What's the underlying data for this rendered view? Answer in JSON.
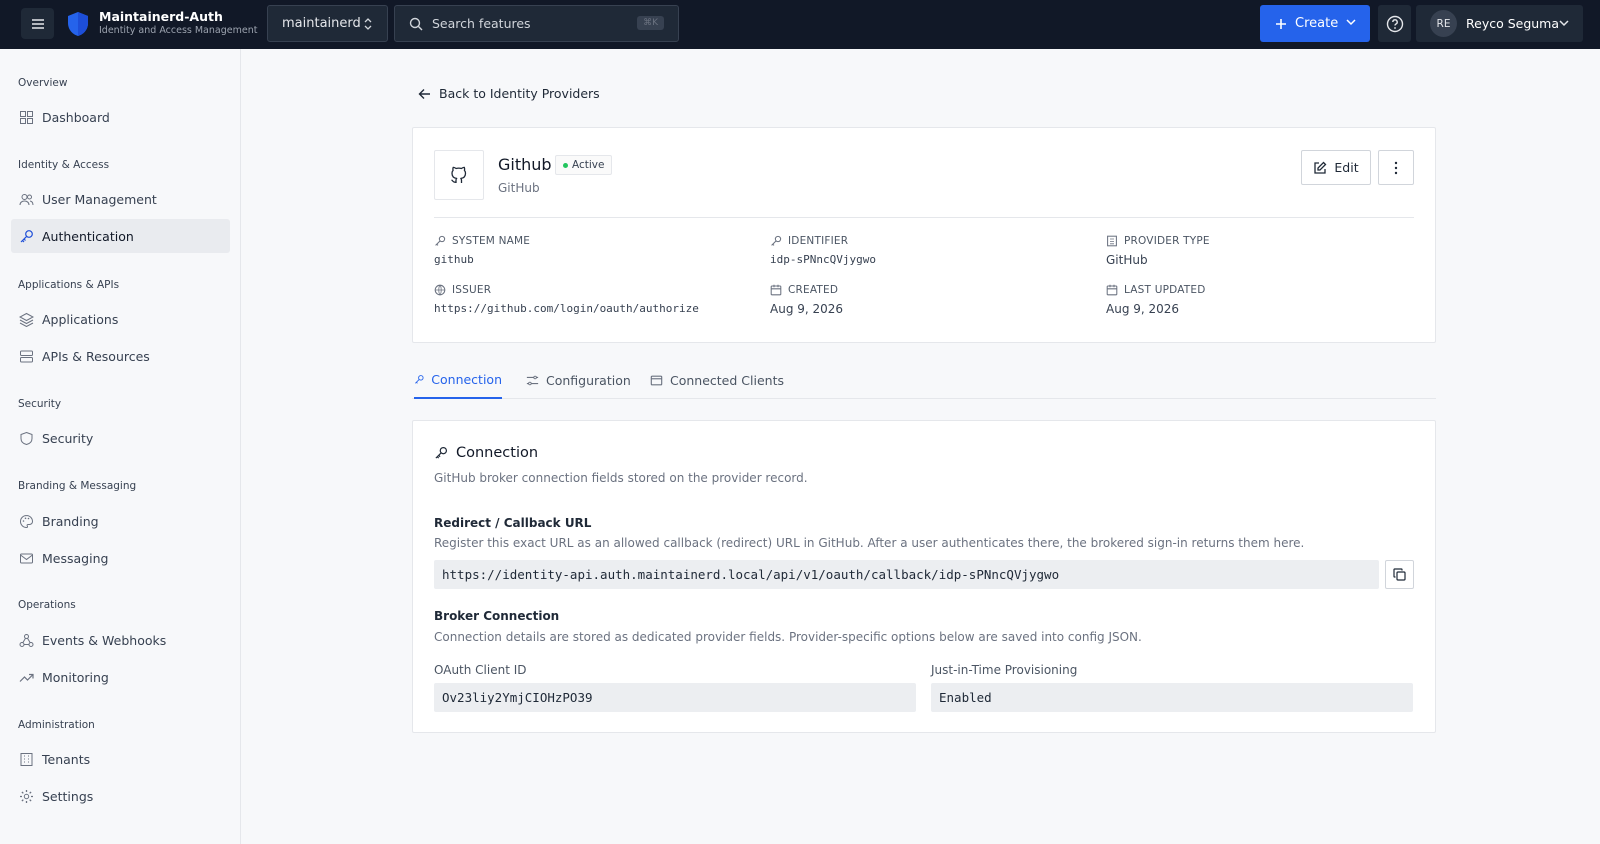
{
  "app": {
    "name": "Maintainerd-Auth",
    "subtitle": "Identity and Access Management",
    "tenant": "maintainerd",
    "search_placeholder": "Search features",
    "search_shortcut": "⌘K",
    "create_label": "Create",
    "user_initials": "RE",
    "user_name": "Reyco Seguma"
  },
  "sidebar": {
    "sections": [
      {
        "title": "Overview",
        "items": [
          "Dashboard"
        ]
      },
      {
        "title": "Identity & Access",
        "items": [
          "User Management",
          "Authentication"
        ]
      },
      {
        "title": "Applications & APIs",
        "items": [
          "Applications",
          "APIs & Resources"
        ]
      },
      {
        "title": "Security",
        "items": [
          "Security"
        ]
      },
      {
        "title": "Branding & Messaging",
        "items": [
          "Branding",
          "Messaging"
        ]
      },
      {
        "title": "Operations",
        "items": [
          "Events & Webhooks",
          "Monitoring"
        ]
      },
      {
        "title": "Administration",
        "items": [
          "Tenants",
          "Settings"
        ]
      }
    ],
    "active_item": "Authentication"
  },
  "page": {
    "back_label": "Back to Identity Providers",
    "provider": {
      "name": "Github",
      "status": "Active",
      "subtitle": "GitHub",
      "edit_label": "Edit",
      "fields": {
        "system_name_label": "SYSTEM NAME",
        "system_name": "github",
        "identifier_label": "IDENTIFIER",
        "identifier": "idp-sPNncQVjygwo",
        "provider_type_label": "PROVIDER TYPE",
        "provider_type": "GitHub",
        "issuer_label": "ISSUER",
        "issuer": "https://github.com/login/oauth/authorize",
        "created_label": "CREATED",
        "created": "Aug 9, 2026",
        "updated_label": "LAST UPDATED",
        "updated": "Aug 9, 2026"
      }
    },
    "tabs": [
      "Connection",
      "Configuration",
      "Connected Clients"
    ],
    "active_tab": "Connection",
    "connection": {
      "title": "Connection",
      "description": "GitHub broker connection fields stored on the provider record.",
      "redirect_title": "Redirect / Callback URL",
      "redirect_desc": "Register this exact URL as an allowed callback (redirect) URL in GitHub. After a user authenticates there, the brokered sign-in returns them here.",
      "redirect_url": "https://identity-api.auth.maintainerd.local/api/v1/oauth/callback/idp-sPNncQVjygwo",
      "broker_title": "Broker Connection",
      "broker_desc": "Connection details are stored as dedicated provider fields. Provider-specific options below are saved into config JSON.",
      "client_id_label": "OAuth Client ID",
      "client_id": "Ov23liy2YmjCIOHzPO39",
      "jit_label": "Just-in-Time Provisioning",
      "jit_value": "Enabled"
    }
  }
}
